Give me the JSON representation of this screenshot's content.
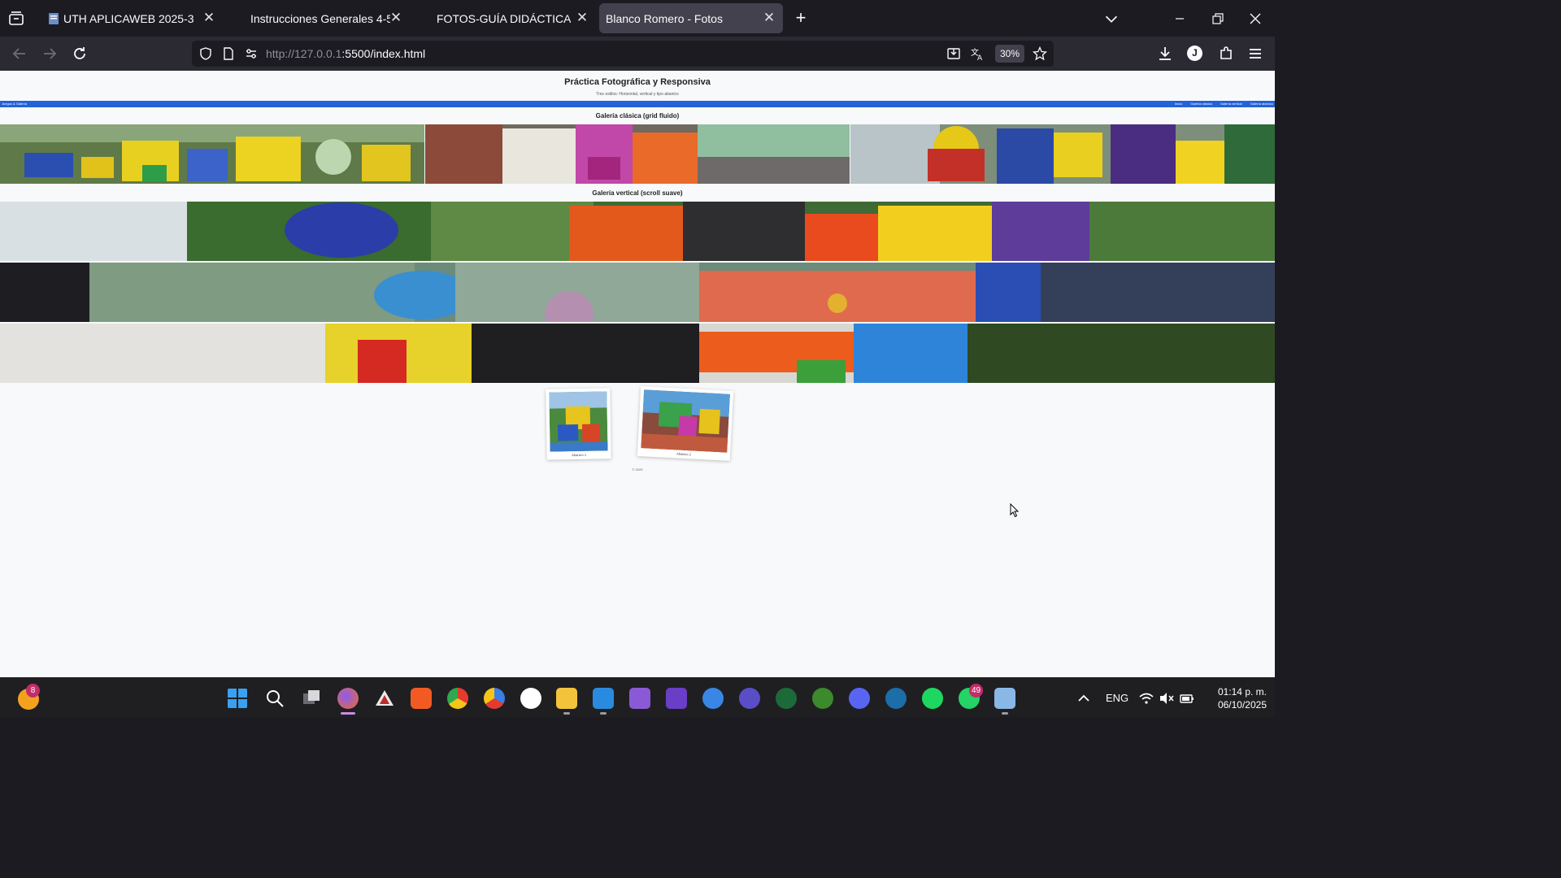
{
  "browser": {
    "tabs": [
      {
        "title": "UTH APLICAWEB 2025-3",
        "active": false
      },
      {
        "title": "Instrucciones Generales 4-5 u2.",
        "active": false
      },
      {
        "title": "FOTOS-GUÍA DIDÁCTICA.pdf",
        "active": false
      },
      {
        "title": "Blanco Romero - Fotos",
        "active": true
      }
    ],
    "url_host": "http://127.0.0.1",
    "url_rest": ":5500/index.html",
    "zoom": "30%",
    "account_initial": "J"
  },
  "page": {
    "title": "Práctica Fotográfica y Responsiva",
    "subtitle": "Tres estilos: Horizontal, vertical y tipo abanico",
    "nav_brand": "Juegos & Galería",
    "nav_links": [
      "Inicio",
      "Galería clásica",
      "Galería vertical",
      "Galería abanico"
    ],
    "section_grid": "Galería clásica (grid fluido)",
    "section_vertical": "Galería vertical (scroll suave)",
    "fan": [
      {
        "caption": "Abanico 1"
      },
      {
        "caption": "Abanico 2"
      }
    ],
    "footer": "© 2025"
  },
  "taskbar": {
    "notif_count": "8",
    "whatsapp_count": "49",
    "language": "ENG",
    "time": "01:14 p. m.",
    "date": "06/10/2025"
  },
  "colors": {
    "chrome_dark": "#1c1b22",
    "nav_bg": "#2b2a33",
    "page_bg": "#f8f9fb",
    "page_nav_blue": "#2362d8"
  }
}
